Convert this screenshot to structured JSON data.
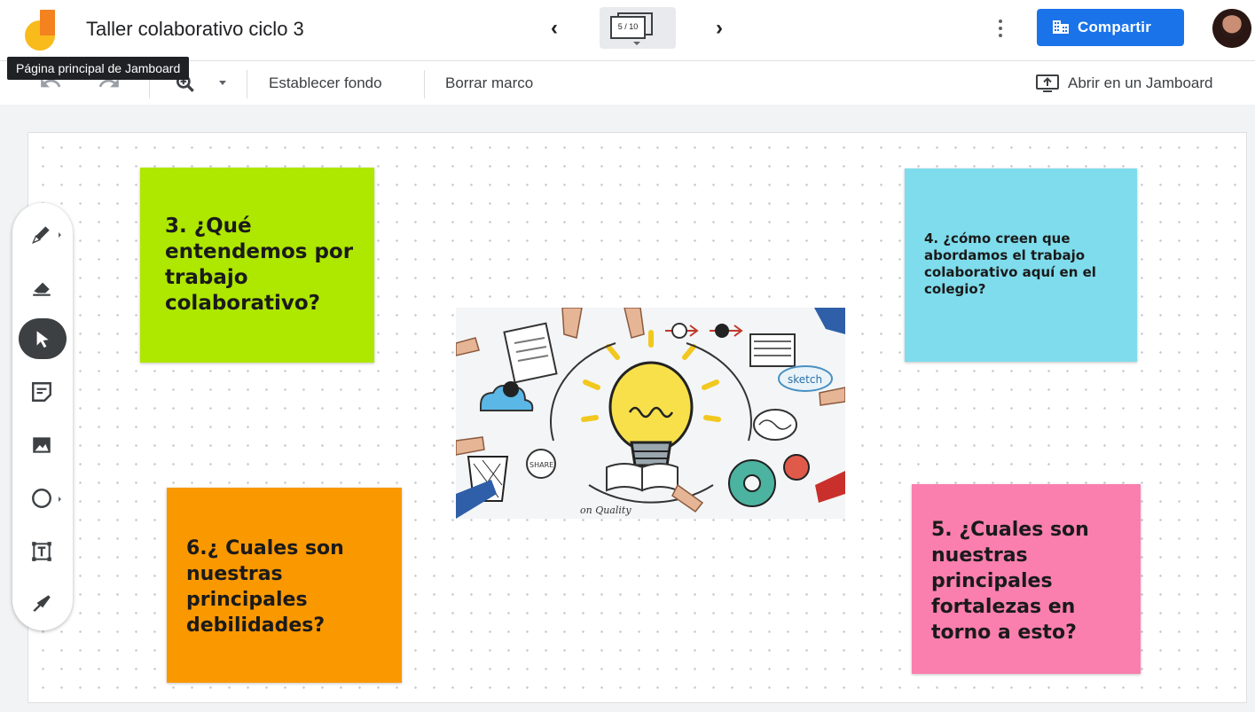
{
  "app": {
    "title": "Taller colaborativo ciclo 3",
    "logo_tooltip": "Página principal de Jamboard"
  },
  "frame_nav": {
    "current": 5,
    "total": 10,
    "label": "5 / 10"
  },
  "header": {
    "share_label": "Compartir",
    "share_color": "#1a73e8"
  },
  "toolbar": {
    "set_background_label": "Establecer fondo",
    "clear_frame_label": "Borrar marco",
    "open_in_jamboard_label": "Abrir en un Jamboard"
  },
  "tools": [
    {
      "name": "pen",
      "icon": "pen-icon"
    },
    {
      "name": "eraser",
      "icon": "eraser-icon"
    },
    {
      "name": "select",
      "icon": "pointer-icon",
      "active": true
    },
    {
      "name": "sticky-note",
      "icon": "sticky-note-icon"
    },
    {
      "name": "image",
      "icon": "image-icon"
    },
    {
      "name": "shape",
      "icon": "circle-icon"
    },
    {
      "name": "text-box",
      "icon": "text-box-icon"
    },
    {
      "name": "laser",
      "icon": "laser-icon"
    }
  ],
  "board": {
    "notes": [
      {
        "text": "3. ¿Qué entendemos por trabajo colaborativo?",
        "color": "#aee700"
      },
      {
        "text": "4. ¿cómo creen que abordamos el trabajo colaborativo aquí en el colegio?",
        "color": "#7edcec"
      },
      {
        "text": "6.¿ Cuales son nuestras principales debilidades?",
        "color": "#fa9800"
      },
      {
        "text": "5. ¿Cuales son nuestras principales fortalezas en torno a esto?",
        "color": "#fa7fae"
      }
    ],
    "image": {
      "icon": "collaboration-lightbulb-image",
      "text_sketch": "sketch",
      "text_share": "SHARE",
      "text_quality": "on Quality"
    }
  }
}
